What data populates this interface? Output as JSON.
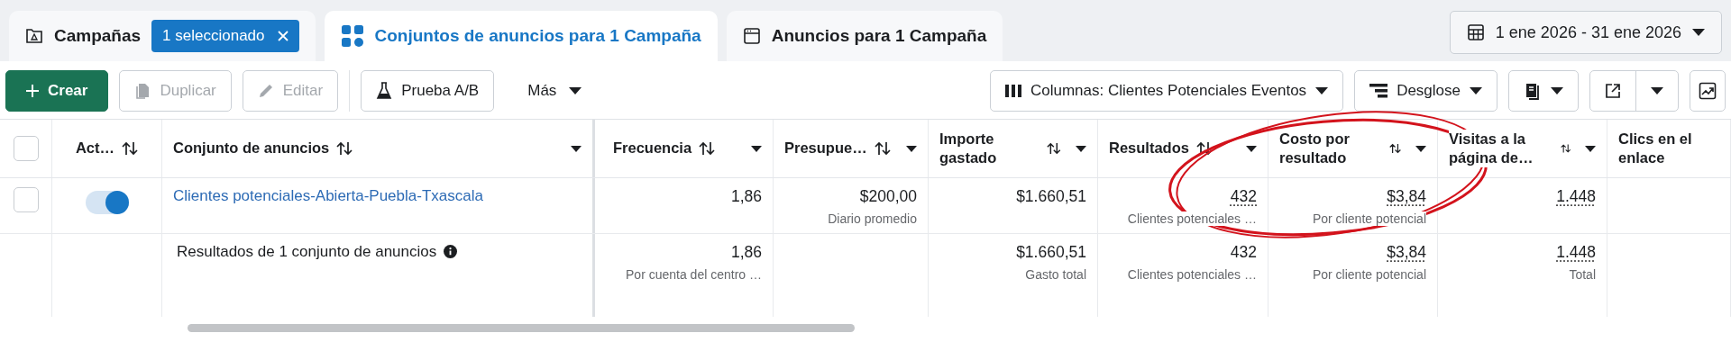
{
  "tabs": [
    {
      "label": "Campañas",
      "selected": false,
      "badge": "1 seleccionado"
    },
    {
      "label": "Conjuntos de anuncios para 1 Campaña",
      "selected": true
    },
    {
      "label": "Anuncios para 1 Campaña",
      "selected": false
    }
  ],
  "date_range": "1 ene 2026 - 31 ene 2026",
  "toolbar": {
    "left": [
      {
        "label": "Crear",
        "kind": "primary",
        "disabled": false
      },
      {
        "label": "Duplicar",
        "kind": "outline",
        "disabled": true
      },
      {
        "label": "Editar",
        "kind": "outline",
        "disabled": true
      },
      {
        "label": "Prueba A/B",
        "kind": "outline",
        "disabled": false
      },
      {
        "label": "Más",
        "kind": "menu",
        "disabled": false
      }
    ],
    "right": [
      {
        "label": "Columnas: Clientes Potenciales Eventos",
        "kind": "dropdown"
      },
      {
        "label": "Desglose",
        "kind": "dropdown"
      },
      {
        "kind": "dropdown"
      },
      {
        "kind": "split"
      },
      {
        "kind": "icon"
      }
    ]
  },
  "table": {
    "select_all_checked": false,
    "pinned_columns": [
      {
        "label": "Act…",
        "sortable": true,
        "menu": false
      },
      {
        "label": "Conjunto de anuncios",
        "sortable": true,
        "menu": true
      }
    ],
    "columns": [
      {
        "label": "Frecuencia",
        "sortable": true,
        "menu": true
      },
      {
        "label": "Presupue…",
        "sortable": true,
        "menu": true
      },
      {
        "label": "Importe gastado",
        "sortable": true,
        "menu": true
      },
      {
        "label": "Resultados",
        "sortable": true,
        "menu": true
      },
      {
        "label": "Costo por resultado",
        "sortable": true,
        "menu": true
      },
      {
        "label": "Visitas a la página de…",
        "sortable": true,
        "menu": true
      },
      {
        "label": "Clics en el enlace",
        "sortable": false,
        "menu": false
      }
    ],
    "rows": [
      {
        "kind": "item",
        "checked": false,
        "on": true,
        "name": "Clientes potenciales-Abierta-Puebla-Txascala",
        "cells": [
          {
            "value": "1,86",
            "underlined": false
          },
          {
            "value": "$200,00",
            "sub": "Diario promedio",
            "underlined": false
          },
          {
            "value": "$1.660,51",
            "underlined": false
          },
          {
            "value": "432",
            "sub": "Clientes potenciales …",
            "underlined": true
          },
          {
            "value": "$3,84",
            "sub": "Por cliente potencial",
            "underlined": true
          },
          {
            "value": "1.448",
            "underlined": true
          }
        ]
      },
      {
        "kind": "summary",
        "label": "Resultados de 1 conjunto de anuncios",
        "cells": [
          {
            "value": "1,86",
            "sub": "Por cuenta del centro …",
            "underlined": false
          },
          null,
          {
            "value": "$1.660,51",
            "sub": "Gasto total",
            "underlined": false
          },
          {
            "value": "432",
            "sub": "Clientes potenciales …",
            "underlined": false
          },
          {
            "value": "$3,84",
            "sub": "Por cliente potencial",
            "underlined": true
          },
          {
            "value": "1.448",
            "sub": "Total",
            "underlined": true
          }
        ]
      }
    ]
  }
}
